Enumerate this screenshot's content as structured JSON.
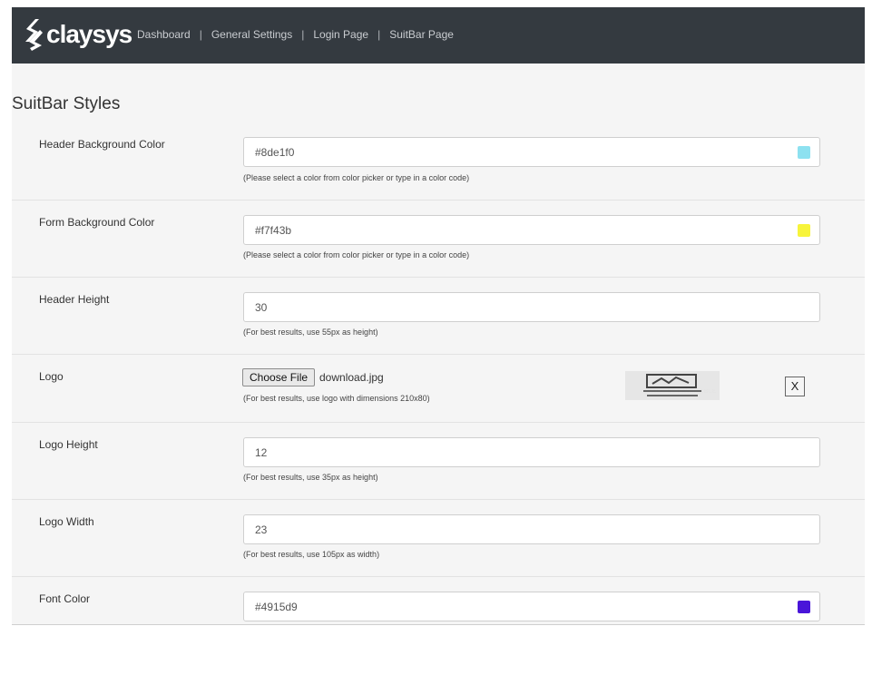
{
  "brand": {
    "name": "claysys"
  },
  "nav": {
    "items": [
      "Dashboard",
      "General Settings",
      "Login Page",
      "SuitBar Page"
    ],
    "separator": "|"
  },
  "page": {
    "title": "SuitBar Styles"
  },
  "fields": {
    "header_bg": {
      "label": "Header Background Color",
      "value": "#8de1f0",
      "swatch": "#8de1f0",
      "hint": "(Please select a color from color picker or type in a color code)"
    },
    "form_bg": {
      "label": "Form Background Color",
      "value": "#f7f43b",
      "swatch": "#f7f43b",
      "hint": "(Please select a color from color picker or type in a color code)"
    },
    "header_height": {
      "label": "Header Height",
      "value": "30",
      "hint": "(For best results, use 55px as height)"
    },
    "logo": {
      "label": "Logo",
      "button": "Choose File",
      "filename": "download.jpg",
      "hint": "(For best results, use logo with dimensions 210x80)",
      "remove": "X",
      "preview_text": "IMAGE NOT AVAILABLE"
    },
    "logo_height": {
      "label": "Logo Height",
      "value": "12",
      "hint": "(For best results, use 35px as height)"
    },
    "logo_width": {
      "label": "Logo Width",
      "value": "23",
      "hint": "(For best results, use 105px as width)"
    },
    "font_color": {
      "label": "Font Color",
      "value": "#4915d9",
      "swatch": "#4915d9"
    }
  }
}
